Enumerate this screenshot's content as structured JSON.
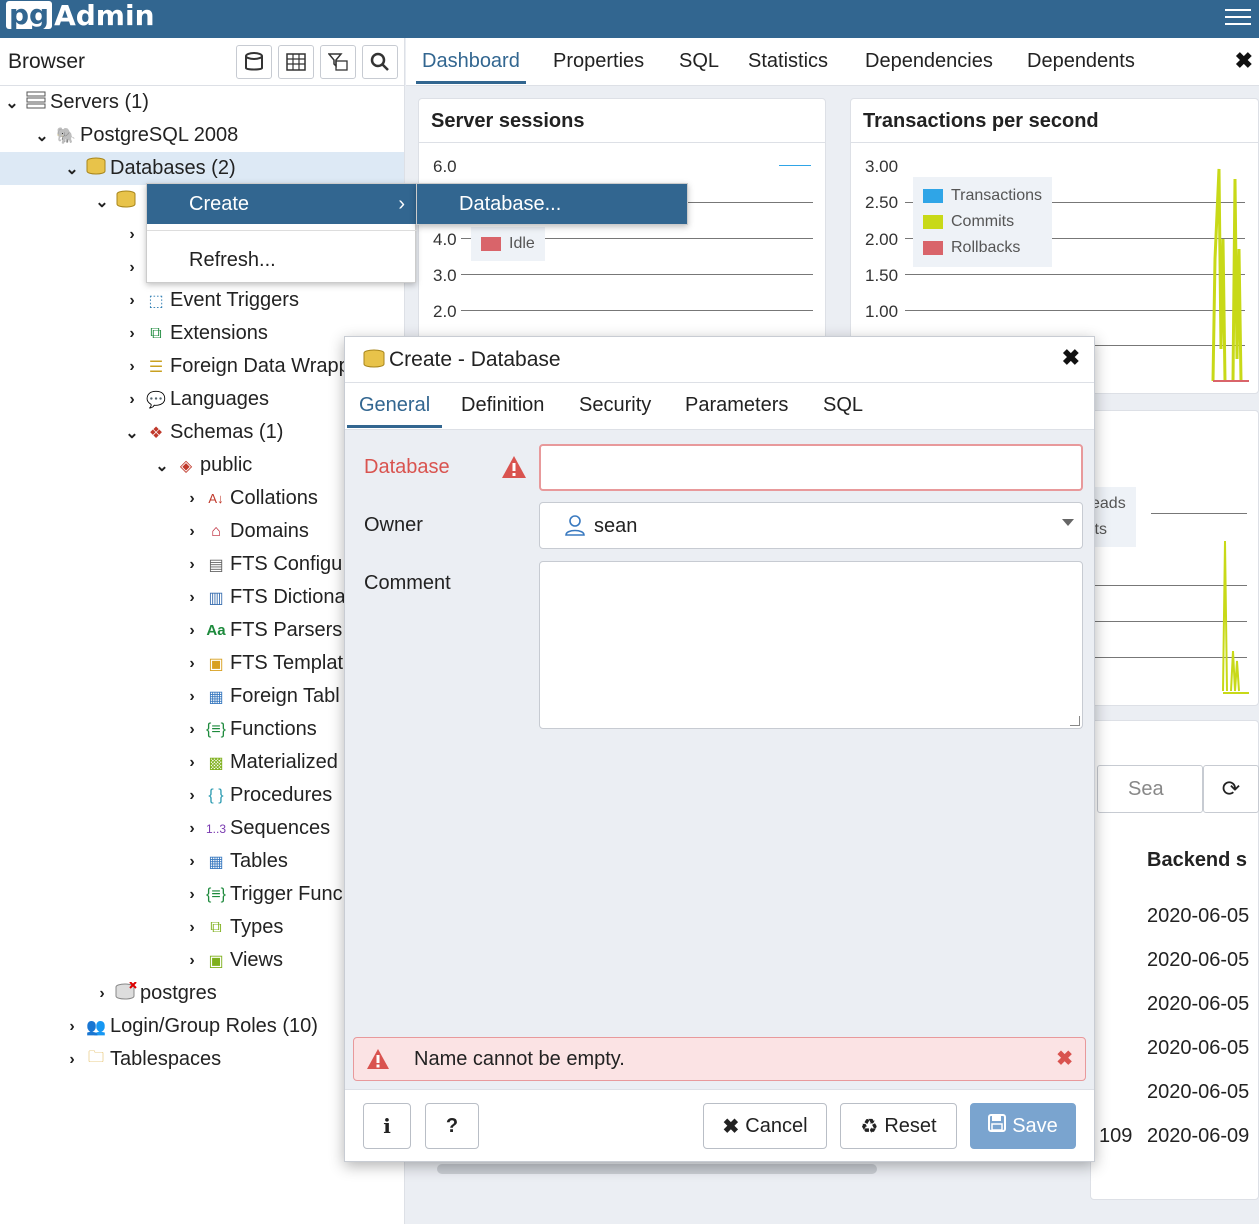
{
  "app": {
    "logo_pg": "pg",
    "logo_admin": "Admin"
  },
  "browser": {
    "title": "Browser",
    "tree": [
      {
        "label": "Servers (1)",
        "icon": "servers-icon"
      },
      {
        "label": "PostgreSQL 2008",
        "icon": "elephant-icon"
      },
      {
        "label": "Databases (2)",
        "icon": "databases-icon"
      },
      {
        "label": "",
        "icon": "database-icon"
      },
      {
        "label": "Event Triggers",
        "icon": "event-trigger-icon"
      },
      {
        "label": "Extensions",
        "icon": "extension-icon"
      },
      {
        "label": "Foreign Data Wrapp",
        "icon": "fdw-icon"
      },
      {
        "label": "Languages",
        "icon": "language-icon"
      },
      {
        "label": "Schemas (1)",
        "icon": "schemas-icon"
      },
      {
        "label": "public",
        "icon": "schema-icon"
      },
      {
        "label": "Collations",
        "icon": "collation-icon"
      },
      {
        "label": "Domains",
        "icon": "domain-icon"
      },
      {
        "label": "FTS Configu",
        "icon": "fts-config-icon"
      },
      {
        "label": "FTS Dictiona",
        "icon": "fts-dictionary-icon"
      },
      {
        "label": "FTS Parsers",
        "icon": "fts-parser-icon"
      },
      {
        "label": "FTS Templat",
        "icon": "fts-template-icon"
      },
      {
        "label": "Foreign Tabl",
        "icon": "foreign-table-icon"
      },
      {
        "label": "Functions",
        "icon": "function-icon"
      },
      {
        "label": "Materialized",
        "icon": "matview-icon"
      },
      {
        "label": "Procedures",
        "icon": "procedure-icon"
      },
      {
        "label": "Sequences",
        "icon": "sequence-icon"
      },
      {
        "label": "Tables",
        "icon": "table-icon"
      },
      {
        "label": "Trigger Func",
        "icon": "trigger-function-icon"
      },
      {
        "label": "Types",
        "icon": "type-icon"
      },
      {
        "label": "Views",
        "icon": "view-icon"
      },
      {
        "label": "postgres",
        "icon": "database-disconnected-icon"
      },
      {
        "label": "Login/Group Roles (10)",
        "icon": "roles-icon"
      },
      {
        "label": "Tablespaces",
        "icon": "tablespace-icon"
      }
    ]
  },
  "tabs": [
    "Dashboard",
    "Properties",
    "SQL",
    "Statistics",
    "Dependencies",
    "Dependents"
  ],
  "dashboard": {
    "sessions": {
      "title": "Server sessions",
      "ticks": [
        "6.0",
        "4.0",
        "3.0",
        "2.0"
      ],
      "legend": [
        "Idle"
      ]
    },
    "tps": {
      "title": "Transactions per second",
      "ticks": [
        "3.00",
        "2.50",
        "2.00",
        "1.50",
        "1.00"
      ],
      "legend": [
        "Transactions",
        "Commits",
        "Rollbacks"
      ]
    },
    "io_legend": [
      "eads",
      "its"
    ],
    "search_placeholder": "Sea",
    "backend_header": "Backend s",
    "backend_dates": [
      "2020-06-05",
      "2020-06-05",
      "2020-06-05",
      "2020-06-05",
      "2020-06-05",
      "2020-06-09"
    ],
    "pid_fragment": "109"
  },
  "context_menu": {
    "create": "Create",
    "refresh": "Refresh...",
    "database": "Database..."
  },
  "dialog": {
    "title": "Create - Database",
    "tabs": [
      "General",
      "Definition",
      "Security",
      "Parameters",
      "SQL"
    ],
    "labels": {
      "database": "Database",
      "owner": "Owner",
      "comment": "Comment"
    },
    "database_value": "",
    "owner_value": "sean",
    "comment_value": "",
    "error": "Name cannot be empty.",
    "buttons": {
      "info": "i",
      "help": "?",
      "cancel": "Cancel",
      "reset": "Reset",
      "save": "Save"
    }
  },
  "colors": {
    "brand": "#326690",
    "error": "#d9534f",
    "transactions": "#2fa5e7",
    "commits": "#c8d918",
    "rollbacks": "#d9646a"
  }
}
